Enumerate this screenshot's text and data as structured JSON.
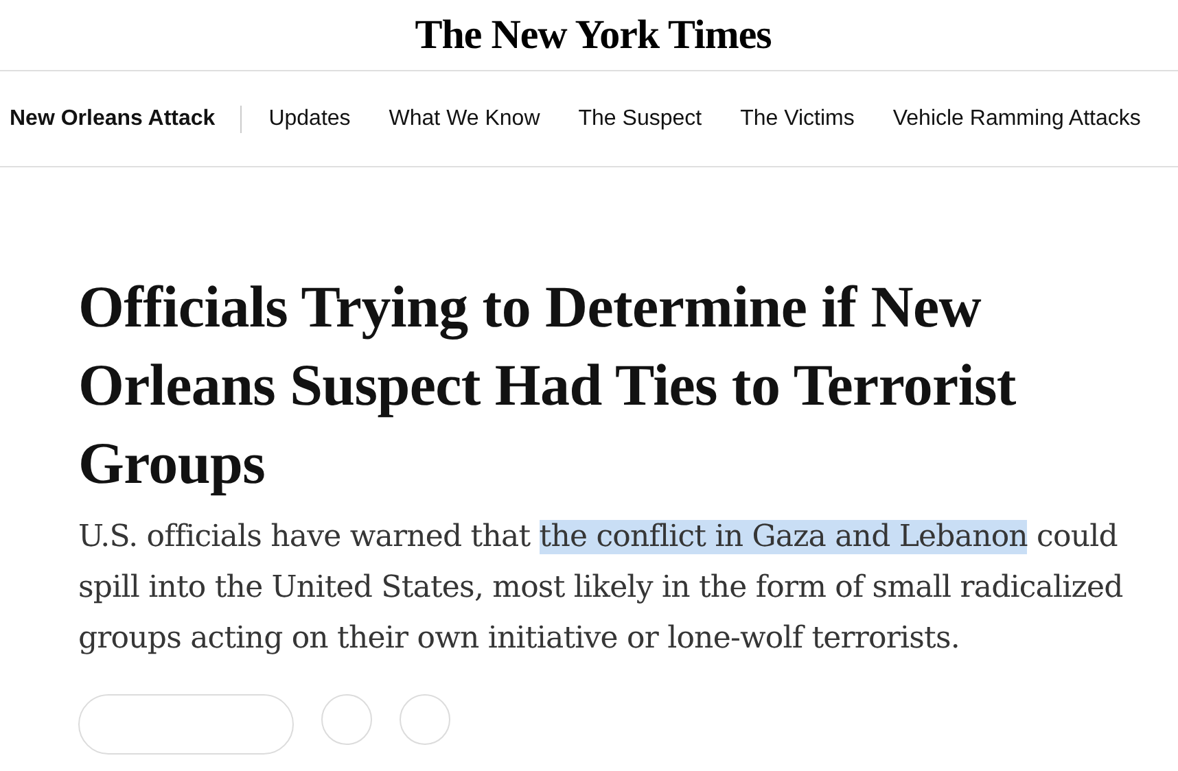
{
  "masthead": {
    "logo": "The New York Times"
  },
  "section_nav": {
    "title": "New Orleans Attack",
    "items": [
      {
        "label": "Updates"
      },
      {
        "label": "What We Know"
      },
      {
        "label": "The Suspect"
      },
      {
        "label": "The Victims"
      },
      {
        "label": "Vehicle Ramming Attacks"
      }
    ]
  },
  "article": {
    "headline": "Officials Trying to Determine if New Orleans Suspect Had Ties to Terrorist Groups",
    "summary": [
      {
        "text": "U.S. officials have warned that ",
        "selected": false
      },
      {
        "text": "the conflict in Gaza and Lebanon",
        "selected": true
      },
      {
        "text": " could spill into the United States, most likely in the form of small radicalized groups acting on their own initiative or lone-wolf terrorists.",
        "selected": false
      }
    ]
  }
}
